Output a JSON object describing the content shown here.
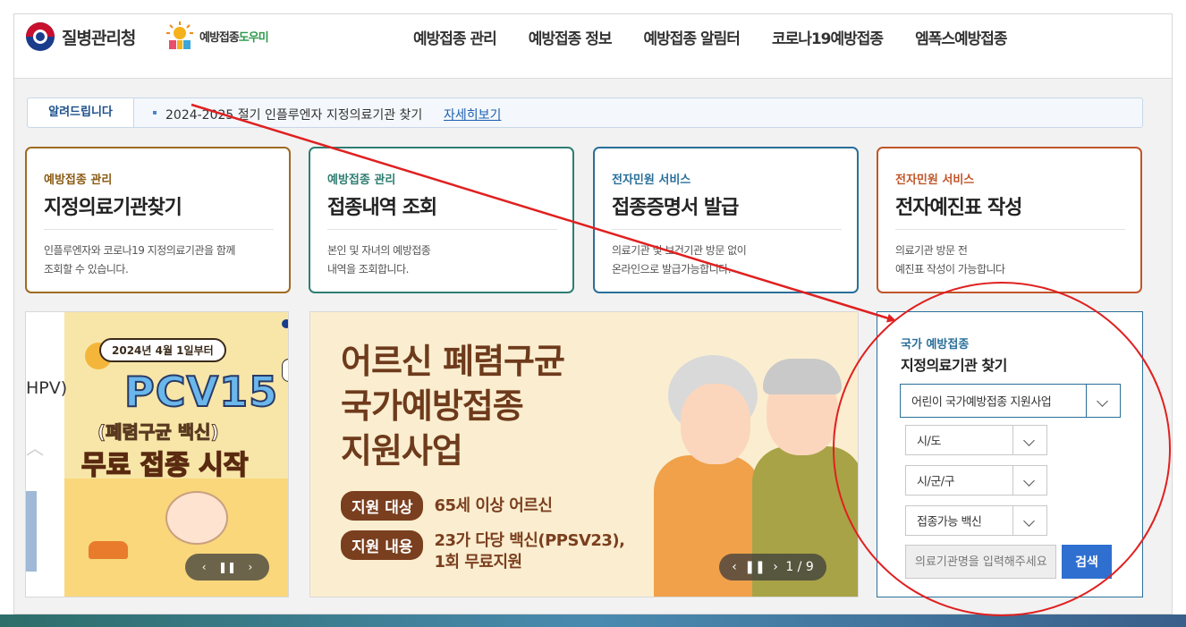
{
  "header": {
    "brand_text": "질병관리청",
    "nip_text_main": "예방접종",
    "nip_text_highlight": "도우미",
    "nav": [
      "예방접종 관리",
      "예방접종 정보",
      "예방접종 알림터",
      "코로나19예방접종",
      "엠폭스예방접종"
    ]
  },
  "notice": {
    "label": "알려드립니다",
    "message": "2024-2025 절기 인플루엔자 지정의료기관 찾기",
    "more_link": "자세히보기"
  },
  "cards": [
    {
      "category": "예방접종 관리",
      "title": "지정의료기관찾기",
      "desc_line1": "인플루엔자와 코로나19 지정의료기관을 함께",
      "desc_line2": "조회할 수 있습니다."
    },
    {
      "category": "예방접종 관리",
      "title": "접종내역 조회",
      "desc_line1": "본인 및 자녀의 예방접종",
      "desc_line2": "내역을 조회합니다."
    },
    {
      "category": "전자민원 서비스",
      "title": "접종증명서 발급",
      "desc_line1": "의료기관 및 보건기관 방문 없이",
      "desc_line2": "온라인으로 발급가능합니다."
    },
    {
      "category": "전자민원 서비스",
      "title": "전자예진표 작성",
      "desc_line1": "의료기관 방문 전",
      "desc_line2": "예진표 작성이 가능합니다"
    }
  ],
  "banner_left": {
    "partial_text": "HPV)",
    "top_pill": "2024년 4월 1일부터",
    "title": "PCV15",
    "subtitle": "(폐렴구균 백신)",
    "tagline": "무료 접종 시작",
    "control_prev": "‹",
    "control_pause": "❚❚",
    "control_next": "›"
  },
  "banner_mid": {
    "headline_line1": "어르신 폐렴구균",
    "headline_line2": "국가예방접종",
    "headline_line3": "지원사업",
    "target_tag": "지원 대상",
    "target_value": "65세 이상 어르신",
    "content_tag": "지원 내용",
    "content_value_line1": "23가 다당 백신(PPSV23),",
    "content_value_line2": "1회 무료지원",
    "control_prev": "‹",
    "control_pause": "❚❚",
    "control_next": "›",
    "pager": "1 / 9"
  },
  "finder": {
    "category": "국가 예방접종",
    "title": "지정의료기관 찾기",
    "program_select": "어린이 국가예방접종 지원사업",
    "sido_select": "시/도",
    "sigungu_select": "시/군/구",
    "vaccine_select": "접종가능 백신",
    "search_placeholder": "의료기관명을 입력해주세요",
    "search_button": "검색"
  },
  "colors": {
    "annotation_red": "#e02020",
    "brand_blue": "#2a6f9a",
    "search_button": "#2f6fd0"
  }
}
